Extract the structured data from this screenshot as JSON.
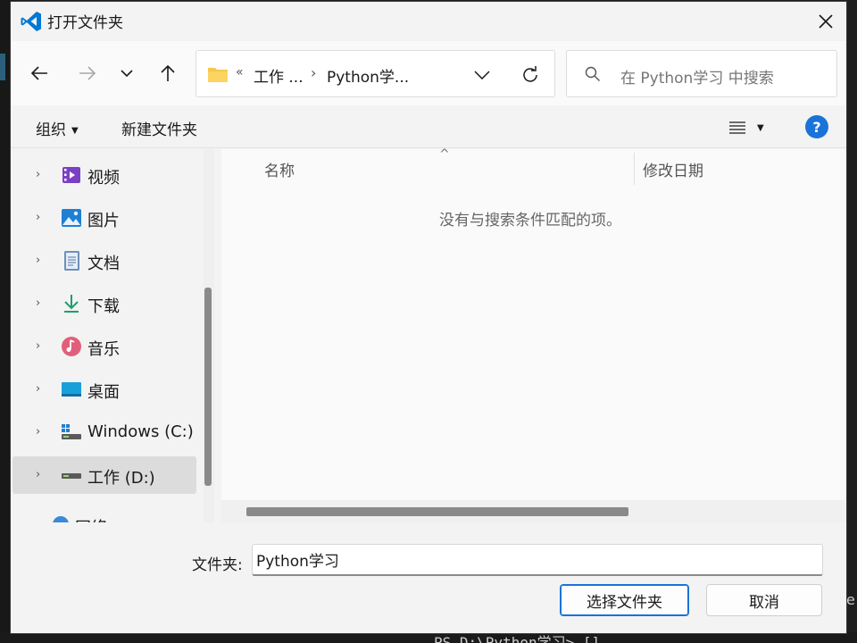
{
  "window": {
    "title": "打开文件夹"
  },
  "address": {
    "overflow_glyph": "«",
    "crumb1": "工作 ...",
    "separator": "›",
    "crumb2": "Python学..."
  },
  "search": {
    "placeholder": "在 Python学习 中搜索"
  },
  "toolbar": {
    "organize": "组织",
    "new_folder": "新建文件夹",
    "help": "?"
  },
  "sidebar": {
    "items": [
      {
        "label": "视频",
        "icon": "video-icon"
      },
      {
        "label": "图片",
        "icon": "picture-icon"
      },
      {
        "label": "文档",
        "icon": "document-icon"
      },
      {
        "label": "下载",
        "icon": "download-icon"
      },
      {
        "label": "音乐",
        "icon": "music-icon"
      },
      {
        "label": "桌面",
        "icon": "desktop-icon"
      },
      {
        "label": "Windows  (C:)",
        "icon": "drive-c-icon"
      },
      {
        "label": "工作 (D:)",
        "icon": "drive-d-icon",
        "selected": true
      }
    ],
    "partial_item": "网络"
  },
  "filelist": {
    "columns": {
      "name": "名称",
      "date": "修改日期"
    },
    "empty_message": "没有与搜索条件匹配的项。"
  },
  "bottom": {
    "folder_label": "文件夹:",
    "folder_value": "Python学习",
    "select_button": "选择文件夹",
    "cancel_button": "取消"
  },
  "background": {
    "terminal_text": "PS D:\\Python学习> []",
    "edge_char": "e"
  },
  "colors": {
    "accent": "#1a73d8",
    "vscode_blue": "#0078d4"
  }
}
